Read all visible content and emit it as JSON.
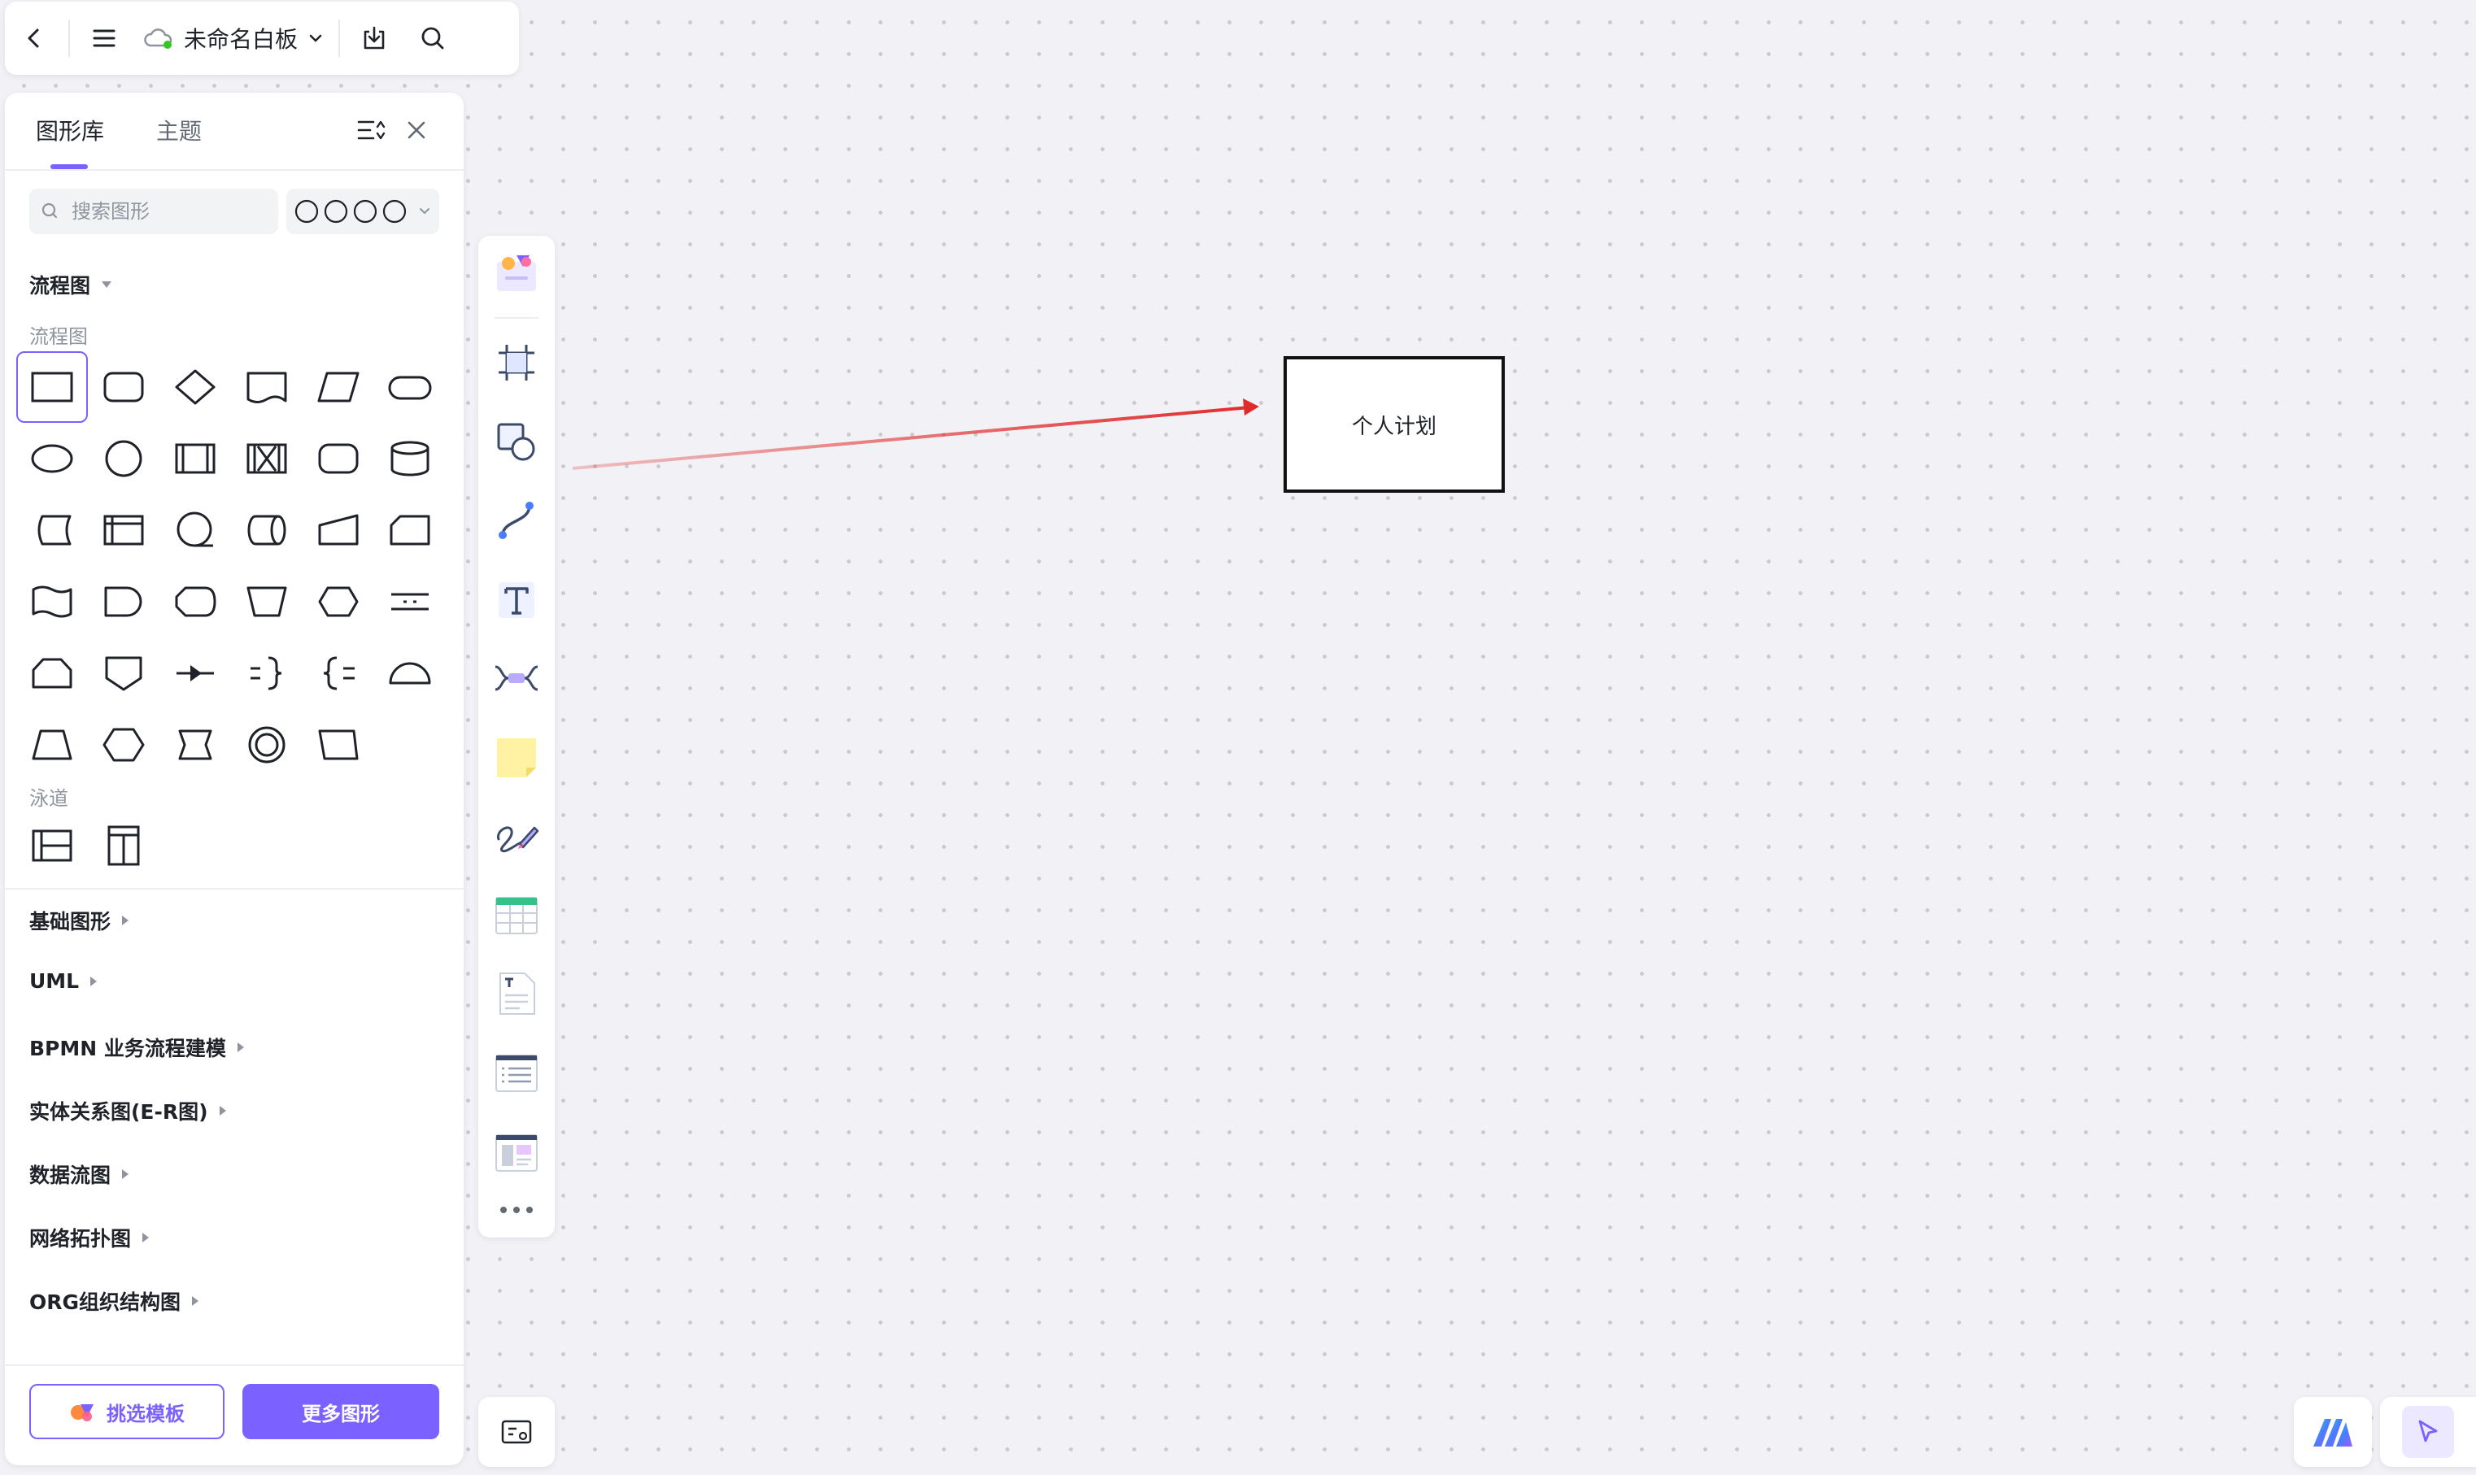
{
  "topbar": {
    "doc_title": "未命名白板",
    "icons": [
      "back-icon",
      "menu-icon",
      "cloud-sync-icon",
      "chevron-down-icon",
      "download-icon",
      "search-icon"
    ]
  },
  "panel": {
    "tabs": [
      {
        "label": "图形库",
        "active": true
      },
      {
        "label": "主题",
        "active": false
      }
    ],
    "search_placeholder": "搜索图形",
    "flowchart_header": "流程图",
    "flowchart_sublabel": "流程图",
    "swimlane_sublabel": "泳道",
    "categories": [
      "基础图形",
      "UML",
      "BPMN 业务流程建模",
      "实体关系图(E-R图)",
      "数据流图",
      "网络拓扑图",
      "ORG组织结构图"
    ],
    "buttons": {
      "templates": "挑选模板",
      "more_shapes": "更多图形"
    }
  },
  "toolbar": {
    "items": [
      "templates-icon",
      "frame-icon",
      "shape-icon",
      "connector-icon",
      "text-icon",
      "mindmap-icon",
      "sticky-note-icon",
      "pen-icon",
      "table-icon",
      "document-icon",
      "list-icon",
      "layout-icon",
      "more-icon"
    ]
  },
  "canvas": {
    "node_label": "个人计划",
    "arrow_color": "#e02b2b",
    "accent": "#7b61ff"
  }
}
